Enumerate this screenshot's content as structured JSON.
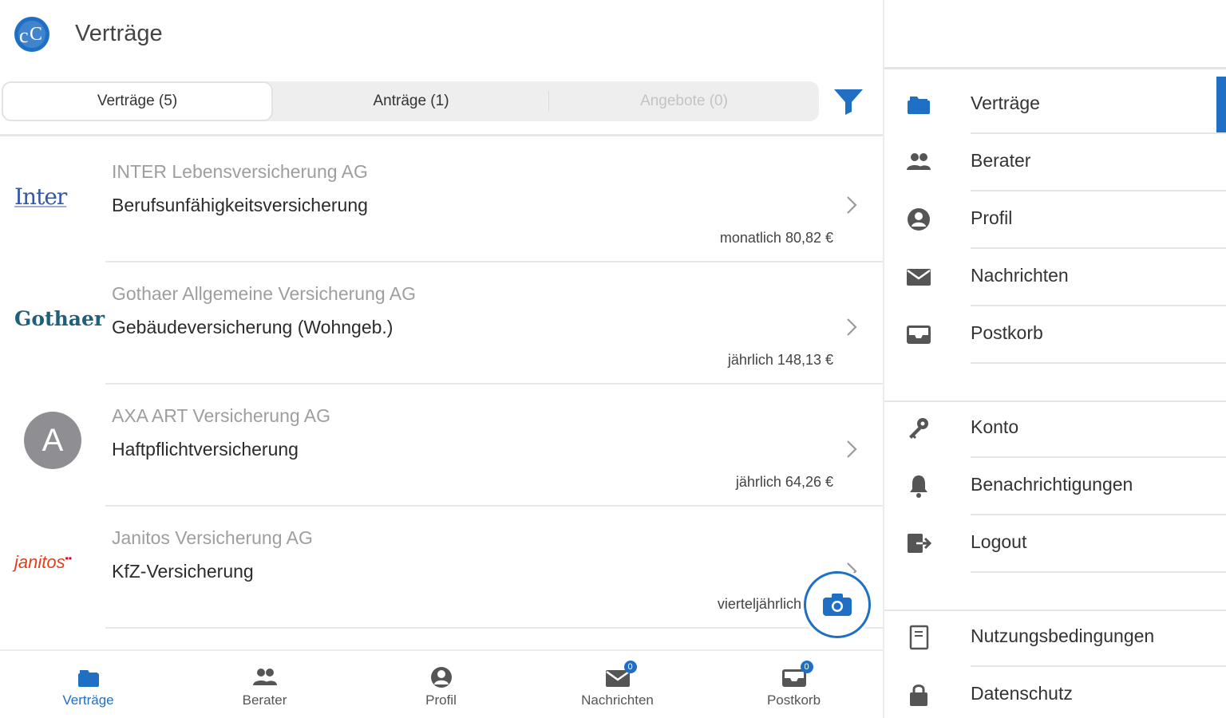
{
  "header": {
    "title": "Verträge"
  },
  "segments": [
    {
      "label": "Verträge (5)",
      "active": true
    },
    {
      "label": "Anträge (1)",
      "active": false
    },
    {
      "label": "Angebote (0)",
      "active": false
    }
  ],
  "contracts": [
    {
      "insurer": "INTER Lebensversicherung AG",
      "product": "Berufsunfähigkeitsversicherung",
      "price": "monatlich 80,82 €",
      "logo_text": "Inter"
    },
    {
      "insurer": "Gothaer Allgemeine Versicherung AG",
      "product": "Gebäudeversicherung (Wohngeb.)",
      "price": "jährlich 148,13 €",
      "logo_text": "Gothaer"
    },
    {
      "insurer": "AXA ART Versicherung AG",
      "product": "Haftpflichtversicherung",
      "price": "jährlich 64,26 €",
      "logo_text": "A"
    },
    {
      "insurer": "Janitos Versicherung AG",
      "product": "KfZ-Versicherung",
      "price": "vierteljährlich 163,",
      "logo_text": "janitos"
    }
  ],
  "bottom_nav": [
    {
      "label": "Verträge",
      "icon": "folder-icon",
      "badge": "",
      "active": true
    },
    {
      "label": "Berater",
      "icon": "people-icon",
      "badge": "",
      "active": false
    },
    {
      "label": "Profil",
      "icon": "person-icon",
      "badge": "",
      "active": false
    },
    {
      "label": "Nachrichten",
      "icon": "mail-icon",
      "badge": "0",
      "active": false
    },
    {
      "label": "Postkorb",
      "icon": "inbox-icon",
      "badge": "0",
      "active": false
    }
  ],
  "drawer": {
    "items": [
      {
        "label": "Verträge",
        "icon": "folder-icon",
        "active": true
      },
      {
        "label": "Berater",
        "icon": "people-icon"
      },
      {
        "label": "Profil",
        "icon": "person-icon"
      },
      {
        "label": "Nachrichten",
        "icon": "mail-icon"
      },
      {
        "label": "Postkorb",
        "icon": "inbox-icon"
      },
      {
        "label": "Konto",
        "icon": "key-icon"
      },
      {
        "label": "Benachrichtigungen",
        "icon": "bell-icon"
      },
      {
        "label": "Logout",
        "icon": "logout-icon"
      },
      {
        "label": "Nutzungsbedingungen",
        "icon": "document-icon"
      },
      {
        "label": "Datenschutz",
        "icon": "lock-icon"
      }
    ]
  },
  "colors": {
    "accent": "#1f6fc5",
    "icon_gray": "#555555",
    "muted_text": "#9e9e9e"
  }
}
